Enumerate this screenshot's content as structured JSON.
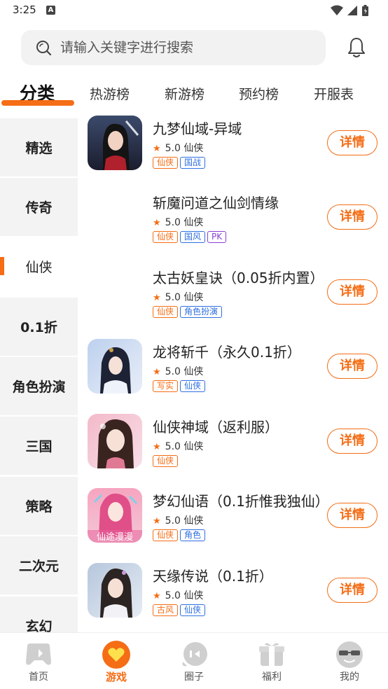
{
  "status_bar": {
    "time": "3:25",
    "notification_glyph": "A",
    "icons": [
      "wifi-icon",
      "signal-icon",
      "battery-icon"
    ]
  },
  "search": {
    "placeholder": "请输入关键字进行搜索"
  },
  "tabs": [
    {
      "label": "分类",
      "active": true
    },
    {
      "label": "热游榜",
      "active": false
    },
    {
      "label": "新游榜",
      "active": false
    },
    {
      "label": "预约榜",
      "active": false
    },
    {
      "label": "开服表",
      "active": false
    }
  ],
  "sidebar": {
    "items": [
      {
        "label": "精选"
      },
      {
        "label": "传奇"
      },
      {
        "label": "仙侠",
        "active": true
      },
      {
        "label": "0.1折"
      },
      {
        "label": "角色扮演"
      },
      {
        "label": "三国"
      },
      {
        "label": "策略"
      },
      {
        "label": "二次元"
      },
      {
        "label": "玄幻"
      }
    ]
  },
  "games": [
    {
      "name": "九梦仙域-异域",
      "score": "5.0",
      "category": "仙侠",
      "detail": "详情",
      "has_icon": true,
      "tags": [
        {
          "text": "仙侠",
          "color": "orange"
        },
        {
          "text": "国战",
          "color": "blue"
        }
      ]
    },
    {
      "name": "斩魔问道之仙剑情缘",
      "score": "5.0",
      "category": "仙侠",
      "detail": "详情",
      "has_icon": false,
      "tags": [
        {
          "text": "仙侠",
          "color": "orange"
        },
        {
          "text": "国风",
          "color": "blue"
        },
        {
          "text": "PK",
          "color": "purple"
        }
      ]
    },
    {
      "name": "太古妖皇诀（0.05折内置）",
      "score": "5.0",
      "category": "仙侠",
      "detail": "详情",
      "has_icon": false,
      "tags": [
        {
          "text": "仙侠",
          "color": "orange"
        },
        {
          "text": "角色扮演",
          "color": "blue"
        }
      ]
    },
    {
      "name": "龙将斩千（永久0.1折）",
      "score": "5.0",
      "category": "仙侠",
      "detail": "详情",
      "has_icon": true,
      "tags": [
        {
          "text": "写实",
          "color": "orange"
        },
        {
          "text": "仙侠",
          "color": "blue"
        }
      ]
    },
    {
      "name": "仙侠神域（返利服）",
      "score": "5.0",
      "category": "仙侠",
      "detail": "详情",
      "has_icon": true,
      "tags": [
        {
          "text": "仙侠",
          "color": "orange"
        }
      ]
    },
    {
      "name": "梦幻仙语（0.1折惟我独仙）",
      "score": "5.0",
      "category": "仙侠",
      "detail": "详情",
      "has_icon": true,
      "icon_caption": "仙途漫漫",
      "tags": [
        {
          "text": "仙侠",
          "color": "orange"
        },
        {
          "text": "角色",
          "color": "blue"
        }
      ]
    },
    {
      "name": "天缘传说（0.1折）",
      "score": "5.0",
      "category": "仙侠",
      "detail": "详情",
      "has_icon": true,
      "tags": [
        {
          "text": "古风",
          "color": "orange"
        },
        {
          "text": "仙侠",
          "color": "blue"
        }
      ]
    }
  ],
  "bottom_nav": [
    {
      "label": "首页",
      "icon": "gamepad-icon",
      "active": false
    },
    {
      "label": "游戏",
      "icon": "heart-icon",
      "active": true
    },
    {
      "label": "圈子",
      "icon": "chat-icon",
      "active": false
    },
    {
      "label": "福利",
      "icon": "gift-icon",
      "active": false
    },
    {
      "label": "我的",
      "icon": "face-icon",
      "active": false
    }
  ],
  "colors": {
    "accent": "#f56d15",
    "tag_blue": "#2f6fe0",
    "tag_purple": "#8a3fd6",
    "sidebar_bg": "#f3f3f3",
    "nav_icon": "#cfcfcf"
  }
}
